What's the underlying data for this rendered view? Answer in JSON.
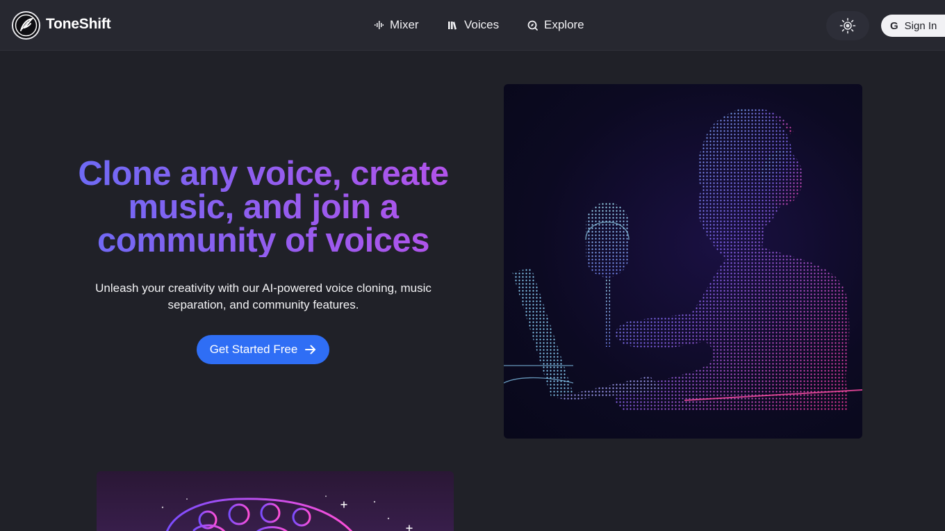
{
  "brand": {
    "name": "ToneShift",
    "logo_icon": "feather-swirl-logo"
  },
  "nav": {
    "items": [
      {
        "label": "Mixer",
        "icon": "waveform-icon"
      },
      {
        "label": "Voices",
        "icon": "library-icon"
      },
      {
        "label": "Explore",
        "icon": "compass-search-icon"
      }
    ]
  },
  "header_actions": {
    "theme_icon": "sun-icon",
    "signin_label": "Sign In",
    "signin_icon": "google-icon"
  },
  "hero": {
    "title": "Clone any voice, create music, and join a community of voices",
    "subtitle": "Unleash your creativity with our AI-powered voice cloning, music separation, and community features.",
    "cta_label": "Get Started Free",
    "image_alt": "person-with-headphones-microphone-laptop-illustration"
  },
  "colors": {
    "background": "#202128",
    "header": "#272830",
    "cta": "#2f6ef5",
    "title_gradient_start": "#6a6cf6",
    "title_gradient_end": "#b652ea"
  }
}
